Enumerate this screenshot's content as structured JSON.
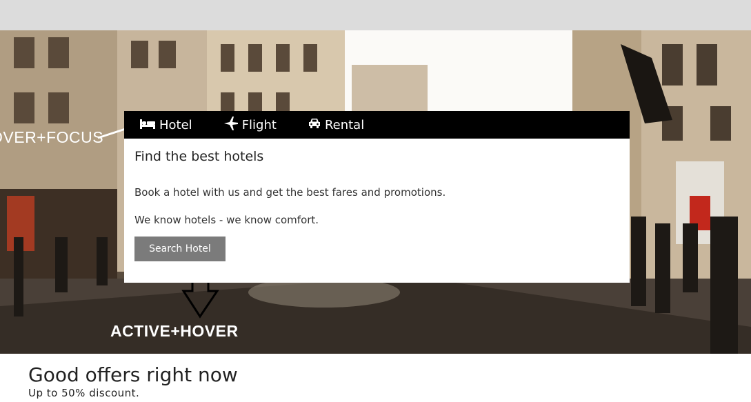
{
  "tabs": [
    {
      "label": "Hotel",
      "icon": "bed-icon"
    },
    {
      "label": "Flight",
      "icon": "plane-icon"
    },
    {
      "label": "Rental",
      "icon": "car-icon"
    }
  ],
  "panel": {
    "title": "Find the best hotels",
    "line1": "Book a hotel with us and get the best fares and promotions.",
    "line2": "We know hotels - we know comfort.",
    "button_label": "Search Hotel"
  },
  "annotations": {
    "hover_focus": "OVER+FOCUS",
    "active_hover": "ACTIVE+HOVER"
  },
  "offers": {
    "title": "Good offers right now",
    "subtitle": "Up to 50% discount."
  },
  "colors": {
    "tab_bar": "#000000",
    "button": "#7b7b7b",
    "top_bar": "#dcdcdc"
  }
}
